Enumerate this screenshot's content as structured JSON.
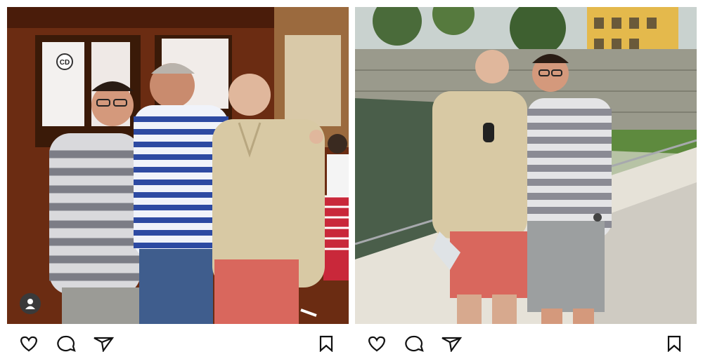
{
  "image": {
    "left_photo": {
      "sign_text": "CD",
      "badge_icon": "user-icon"
    },
    "right_photo": {}
  },
  "toolbar": {
    "icons": [
      "heart-icon",
      "comment-icon",
      "share-icon",
      "bookmark-icon"
    ]
  },
  "colors": {
    "wood": "#6b2c12",
    "stone": "#9a9a8c",
    "river": "#4a5e4a",
    "beige_shirt": "#d8c9a4",
    "red_shorts": "#d9675d",
    "stripe_shirt": "#8b8b94"
  }
}
